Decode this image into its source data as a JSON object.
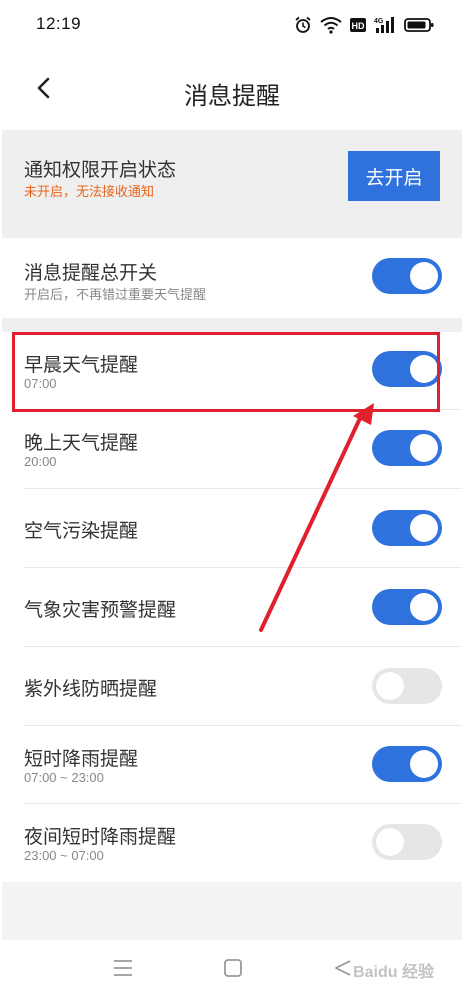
{
  "status_bar": {
    "time": "12:19",
    "icons": [
      "alarm-icon",
      "wifi-icon",
      "hd-icon",
      "4g-signal-icon",
      "battery-icon"
    ]
  },
  "header": {
    "title": "消息提醒",
    "back_icon": "chevron-left-icon"
  },
  "notice": {
    "title": "通知权限开启状态",
    "subtitle": "未开启，无法接收通知",
    "button_label": "去开启",
    "subtitle_color": "#e8651a",
    "button_color": "#2f72de"
  },
  "settings": [
    {
      "title": "消息提醒总开关",
      "subtitle": "开启后，不再错过重要天气提醒",
      "enabled": true
    },
    {
      "title": "早晨天气提醒",
      "subtitle": "07:00",
      "enabled": true
    },
    {
      "title": "晚上天气提醒",
      "subtitle": "20:00",
      "enabled": true
    },
    {
      "title": "空气污染提醒",
      "subtitle": "",
      "enabled": true
    },
    {
      "title": "气象灾害预警提醒",
      "subtitle": "",
      "enabled": true
    },
    {
      "title": "紫外线防晒提醒",
      "subtitle": "",
      "enabled": false
    },
    {
      "title": "短时降雨提醒",
      "subtitle": "07:00 ~ 23:00",
      "enabled": true
    },
    {
      "title": "夜间短时降雨提醒",
      "subtitle": "23:00 ~ 07:00",
      "enabled": false
    }
  ],
  "colors": {
    "accent": "#2f72de",
    "toggle_off": "#e6e6e6",
    "highlight": "#e0202c"
  },
  "bottom_nav": {
    "icons": [
      "menu-icon",
      "home-icon",
      "back-triangle-icon"
    ]
  },
  "watermark": "Baidu 经验"
}
